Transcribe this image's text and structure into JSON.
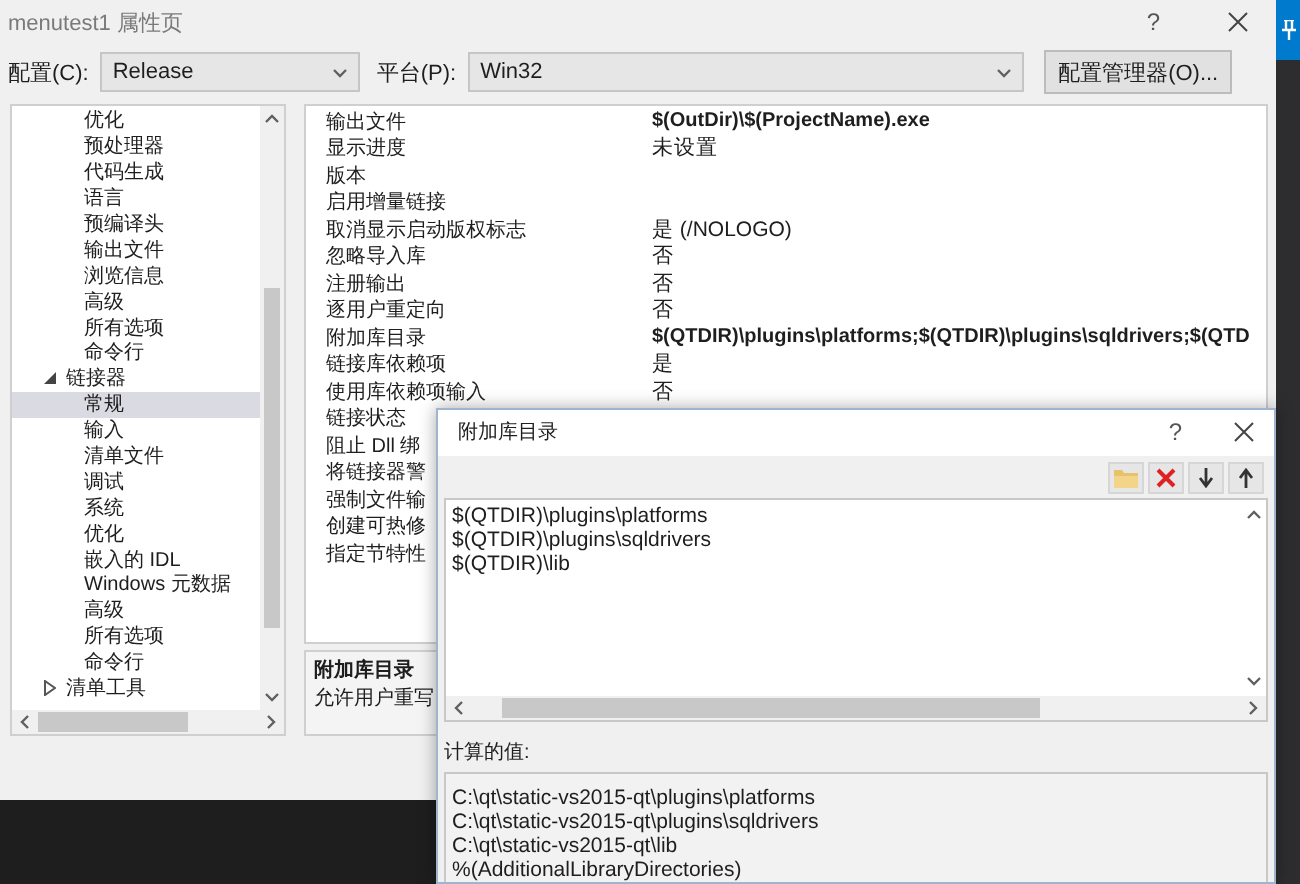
{
  "window": {
    "title": "menutest1 属性页",
    "help": "?"
  },
  "config_bar": {
    "configuration": {
      "label": "配置(C):",
      "value": "Release"
    },
    "platform": {
      "label": "平台(P):",
      "value": "Win32"
    },
    "manager_button": "配置管理器(O)..."
  },
  "tree": {
    "items": [
      {
        "children": [
          {
            "label": "优化",
            "selected": false
          },
          {
            "label": "预处理器",
            "selected": false
          },
          {
            "label": "代码生成",
            "selected": false
          },
          {
            "label": "语言",
            "selected": false
          },
          {
            "label": "预编译头",
            "selected": false
          },
          {
            "label": "输出文件",
            "selected": false
          },
          {
            "label": "浏览信息",
            "selected": false
          },
          {
            "label": "高级",
            "selected": false
          },
          {
            "label": "所有选项",
            "selected": false
          },
          {
            "label": "命令行",
            "selected": false
          }
        ]
      },
      {
        "label": "链接器",
        "expanded": true,
        "selected": false,
        "children": [
          {
            "label": "常规",
            "selected": true
          },
          {
            "label": "输入",
            "selected": false
          },
          {
            "label": "清单文件",
            "selected": false
          },
          {
            "label": "调试",
            "selected": false
          },
          {
            "label": "系统",
            "selected": false
          },
          {
            "label": "优化",
            "selected": false
          },
          {
            "label": "嵌入的 IDL",
            "selected": false
          },
          {
            "label": "Windows 元数据",
            "selected": false
          },
          {
            "label": "高级",
            "selected": false
          },
          {
            "label": "所有选项",
            "selected": false
          },
          {
            "label": "命令行",
            "selected": false
          }
        ]
      },
      {
        "label": "清单工具",
        "expanded": false,
        "selected": false
      }
    ]
  },
  "properties": [
    {
      "name": "输出文件",
      "value": "$(OutDir)\\$(ProjectName).exe",
      "modified": true
    },
    {
      "name": "显示进度",
      "value": "未设置",
      "modified": false
    },
    {
      "name": "版本"
    },
    {
      "name": "启用增量链接"
    },
    {
      "name": "取消显示启动版权标志",
      "value": "是 (/NOLOGO)",
      "modified": false
    },
    {
      "name": "忽略导入库",
      "value": "否",
      "modified": false
    },
    {
      "name": "注册输出",
      "value": "否",
      "modified": false
    },
    {
      "name": "逐用户重定向",
      "value": "否",
      "modified": false
    },
    {
      "name": "附加库目录",
      "value": "$(QTDIR)\\plugins\\platforms;$(QTDIR)\\plugins\\sqldrivers;$(QTD",
      "modified": true
    },
    {
      "name": "链接库依赖项",
      "value": "是",
      "modified": false
    },
    {
      "name": "使用库依赖项输入",
      "value": "否",
      "modified": false
    },
    {
      "name": "链接状态"
    },
    {
      "name": "阻止 Dll 绑"
    },
    {
      "name": "将链接器警"
    },
    {
      "name": "强制文件输"
    },
    {
      "name": "创建可热修"
    },
    {
      "name": "指定节特性"
    }
  ],
  "description": {
    "title": "附加库目录",
    "text": "允许用户重写"
  },
  "dialog": {
    "title": "附加库目录",
    "help": "?",
    "lines": [
      "$(QTDIR)\\plugins\\platforms",
      "$(QTDIR)\\plugins\\sqldrivers",
      "$(QTDIR)\\lib"
    ],
    "computed_label": "计算的值:",
    "computed_lines": [
      "C:\\qt\\static-vs2015-qt\\plugins\\platforms",
      "C:\\qt\\static-vs2015-qt\\plugins\\sqldrivers",
      "C:\\qt\\static-vs2015-qt\\lib",
      "%(AdditionalLibraryDirectories)"
    ]
  }
}
